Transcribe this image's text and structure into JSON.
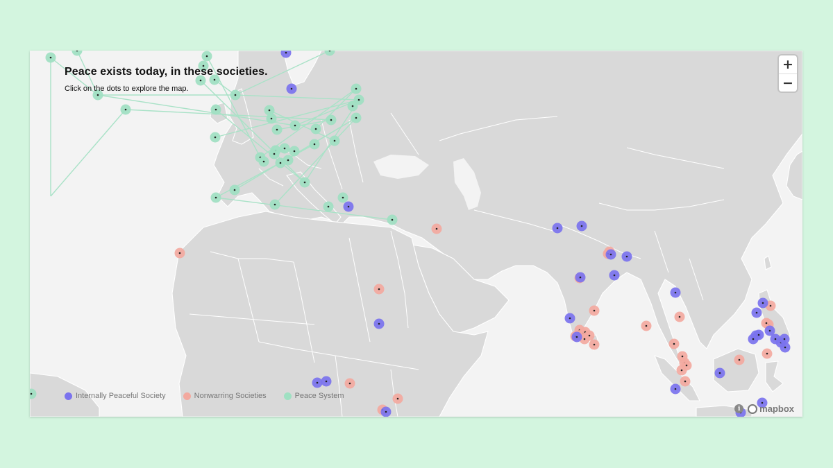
{
  "map": {
    "title": "Peace exists today, in these societies.",
    "subtitle": "Click on the dots to explore the map.",
    "zoom_in_label": "+",
    "zoom_out_label": "−",
    "attribution": "mapbox",
    "info_label": "i"
  },
  "legend": [
    {
      "label": "Internally Peaceful Society",
      "category": "ips"
    },
    {
      "label": "Nonwarring Societies",
      "category": "nws"
    },
    {
      "label": "Peace System",
      "category": "ps"
    }
  ],
  "colors": {
    "ips": "#7b73ee",
    "nws": "#f3a99f",
    "ps": "#9fe0c2",
    "background": "#d3f5df",
    "land": "#d9d9d9",
    "water": "#f3f3f3"
  }
}
